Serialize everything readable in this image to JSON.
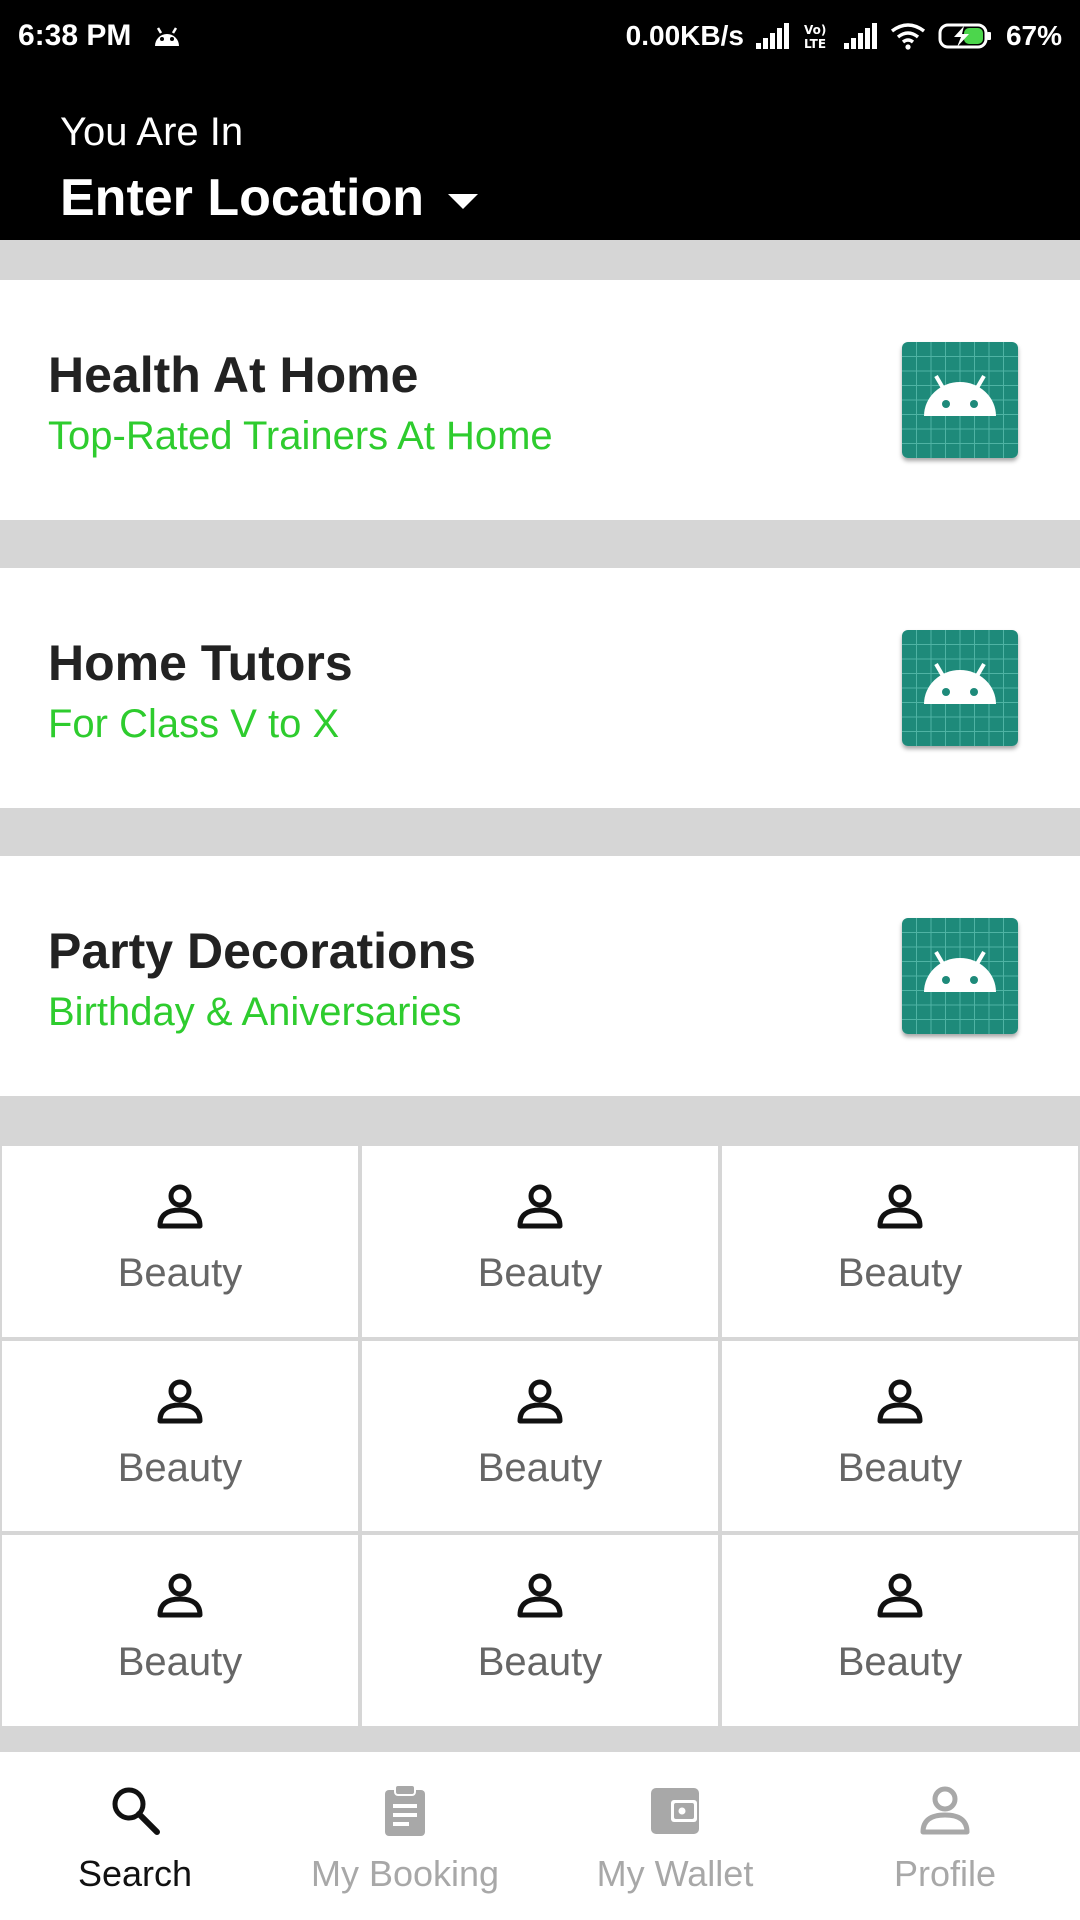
{
  "status_bar": {
    "time": "6:38 PM",
    "net_speed": "0.00KB/s",
    "volte": "Vo) LTE",
    "battery": "67%"
  },
  "header": {
    "subtitle": "You Are In",
    "location": "Enter Location"
  },
  "cards": [
    {
      "title": "Health At Home",
      "subtitle": "Top-Rated Trainers At Home",
      "icon": "android-placeholder-icon"
    },
    {
      "title": "Home Tutors",
      "subtitle": "For Class V to X",
      "icon": "android-placeholder-icon"
    },
    {
      "title": "Party Decorations",
      "subtitle": "Birthday & Aniversaries",
      "icon": "android-placeholder-icon"
    }
  ],
  "categories": [
    {
      "label": "Beauty",
      "icon": "person-icon"
    },
    {
      "label": "Beauty",
      "icon": "person-icon"
    },
    {
      "label": "Beauty",
      "icon": "person-icon"
    },
    {
      "label": "Beauty",
      "icon": "person-icon"
    },
    {
      "label": "Beauty",
      "icon": "person-icon"
    },
    {
      "label": "Beauty",
      "icon": "person-icon"
    },
    {
      "label": "Beauty",
      "icon": "person-icon"
    },
    {
      "label": "Beauty",
      "icon": "person-icon"
    },
    {
      "label": "Beauty",
      "icon": "person-icon"
    }
  ],
  "bottom_nav": [
    {
      "label": "Search",
      "icon": "search-icon",
      "active": true
    },
    {
      "label": "My Booking",
      "icon": "clipboard-icon",
      "active": false
    },
    {
      "label": "My Wallet",
      "icon": "wallet-icon",
      "active": false
    },
    {
      "label": "Profile",
      "icon": "person-icon",
      "active": false
    }
  ],
  "colors": {
    "accent_green": "#2ecc2e",
    "card_image_teal": "#1e8a7a",
    "header_bg": "#000000",
    "divider_gray": "#d6d6d6"
  }
}
